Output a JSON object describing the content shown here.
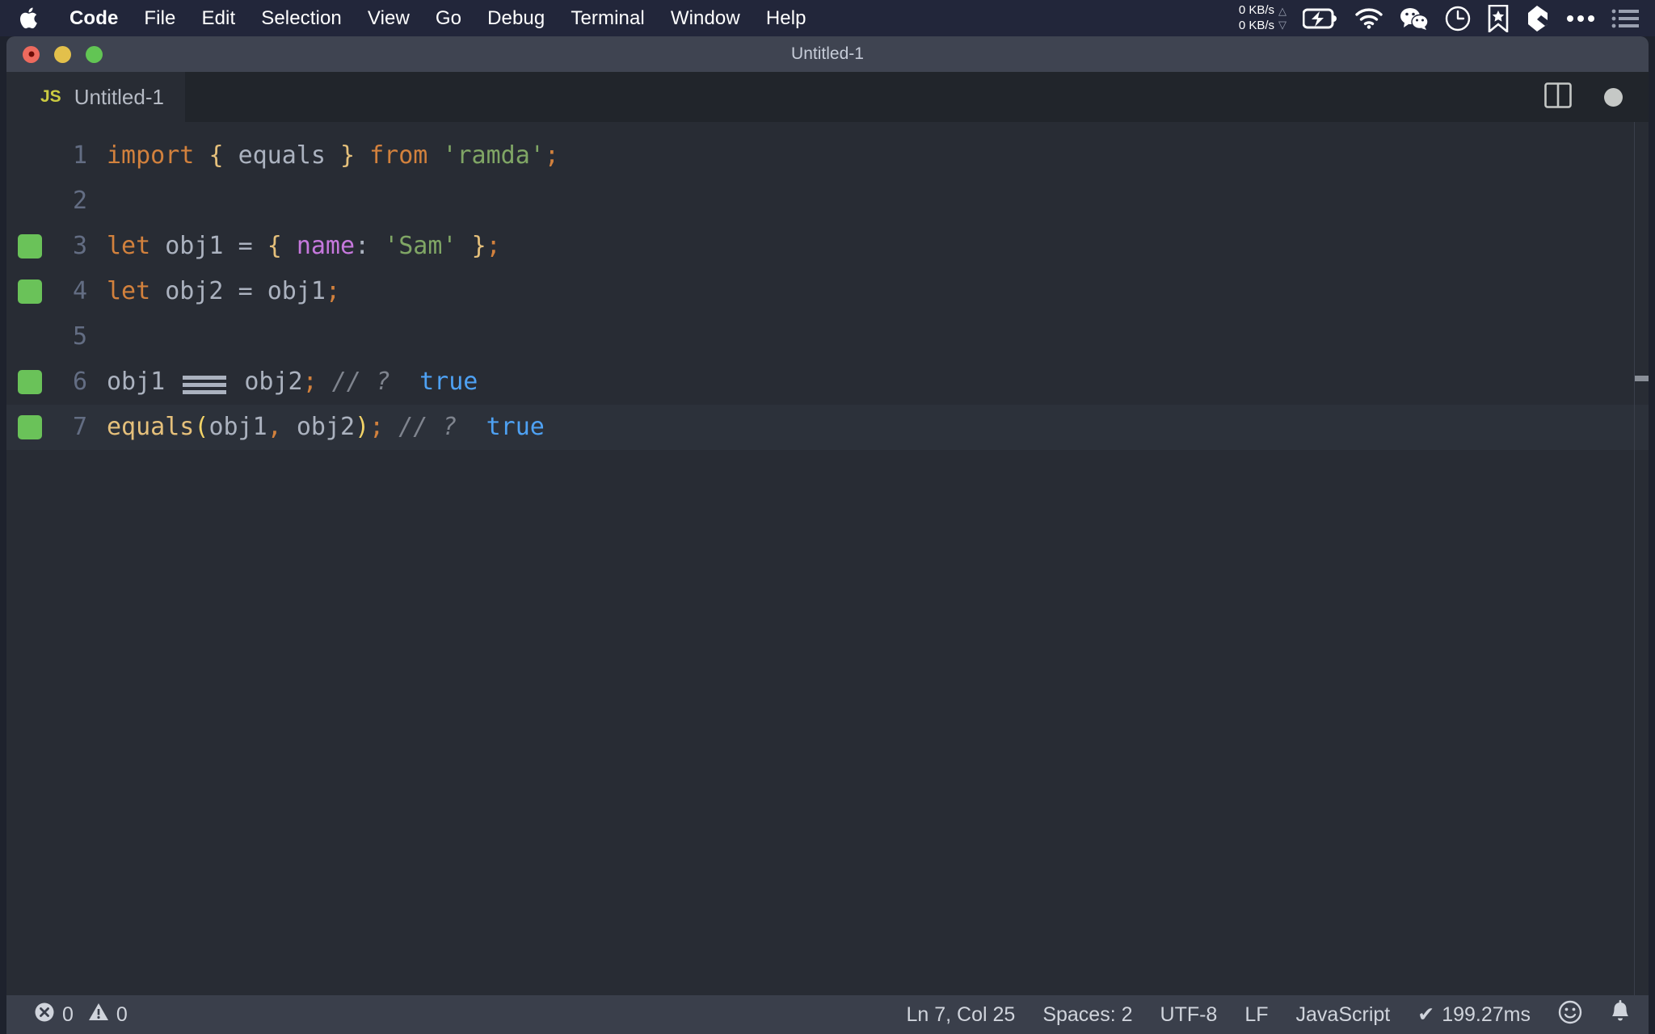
{
  "menubar": {
    "apple_icon": "apple-logo-icon",
    "items": [
      {
        "label": "Code",
        "bold": true
      },
      {
        "label": "File",
        "bold": false
      },
      {
        "label": "Edit",
        "bold": false
      },
      {
        "label": "Selection",
        "bold": false
      },
      {
        "label": "View",
        "bold": false
      },
      {
        "label": "Go",
        "bold": false
      },
      {
        "label": "Debug",
        "bold": false
      },
      {
        "label": "Terminal",
        "bold": false
      },
      {
        "label": "Window",
        "bold": false
      },
      {
        "label": "Help",
        "bold": false
      }
    ],
    "tray": {
      "net_up": "0 KB/s",
      "net_down": "0 KB/s",
      "arrow_up": "△",
      "arrow_down": "▽",
      "icons": [
        "battery-charging-icon",
        "wifi-icon",
        "wechat-icon",
        "clock-icon",
        "bookmark-star-icon",
        "eraser-icon",
        "ellipsis-icon",
        "list-menu-icon"
      ]
    }
  },
  "window": {
    "title": "Untitled-1",
    "traffic_lights": [
      "close-button",
      "minimize-button",
      "maximize-button"
    ]
  },
  "tab": {
    "file_icon_label": "JS",
    "label": "Untitled-1",
    "actions": [
      "split-editor-icon",
      "unsaved-indicator"
    ]
  },
  "editor": {
    "lines": [
      {
        "number": "1",
        "marker": false,
        "current": false,
        "tokens": [
          {
            "text": "import",
            "cls": "t-keyword"
          },
          {
            "text": " ",
            "cls": "t-punct"
          },
          {
            "text": "{",
            "cls": "t-brace"
          },
          {
            "text": " ",
            "cls": "t-punct"
          },
          {
            "text": "equals",
            "cls": "t-ident"
          },
          {
            "text": " ",
            "cls": "t-punct"
          },
          {
            "text": "}",
            "cls": "t-brace"
          },
          {
            "text": " ",
            "cls": "t-punct"
          },
          {
            "text": "from",
            "cls": "t-keyword"
          },
          {
            "text": " ",
            "cls": "t-punct"
          },
          {
            "text": "'ramda'",
            "cls": "t-string"
          },
          {
            "text": ";",
            "cls": "t-semi"
          }
        ]
      },
      {
        "number": "2",
        "marker": false,
        "current": false,
        "tokens": []
      },
      {
        "number": "3",
        "marker": true,
        "current": false,
        "tokens": [
          {
            "text": "let",
            "cls": "t-keyword"
          },
          {
            "text": " ",
            "cls": "t-punct"
          },
          {
            "text": "obj1",
            "cls": "t-ident"
          },
          {
            "text": " ",
            "cls": "t-punct"
          },
          {
            "text": "=",
            "cls": "t-op"
          },
          {
            "text": " ",
            "cls": "t-punct"
          },
          {
            "text": "{",
            "cls": "t-brace"
          },
          {
            "text": " ",
            "cls": "t-punct"
          },
          {
            "text": "name",
            "cls": "t-prop"
          },
          {
            "text": ":",
            "cls": "t-punct"
          },
          {
            "text": " ",
            "cls": "t-punct"
          },
          {
            "text": "'Sam'",
            "cls": "t-string"
          },
          {
            "text": " ",
            "cls": "t-punct"
          },
          {
            "text": "}",
            "cls": "t-brace"
          },
          {
            "text": ";",
            "cls": "t-semi"
          }
        ]
      },
      {
        "number": "4",
        "marker": true,
        "current": false,
        "tokens": [
          {
            "text": "let",
            "cls": "t-keyword"
          },
          {
            "text": " ",
            "cls": "t-punct"
          },
          {
            "text": "obj2",
            "cls": "t-ident"
          },
          {
            "text": " ",
            "cls": "t-punct"
          },
          {
            "text": "=",
            "cls": "t-op"
          },
          {
            "text": " ",
            "cls": "t-punct"
          },
          {
            "text": "obj1",
            "cls": "t-ident"
          },
          {
            "text": ";",
            "cls": "t-semi"
          }
        ]
      },
      {
        "number": "5",
        "marker": false,
        "current": false,
        "tokens": []
      },
      {
        "number": "6",
        "marker": true,
        "current": false,
        "tokens": [
          {
            "text": "obj1",
            "cls": "t-ident"
          },
          {
            "text": " ",
            "cls": "t-punct"
          },
          {
            "text": "===",
            "cls": "t-op",
            "ligature": true
          },
          {
            "text": " ",
            "cls": "t-punct"
          },
          {
            "text": "obj2",
            "cls": "t-ident"
          },
          {
            "text": ";",
            "cls": "t-semi"
          },
          {
            "text": " ",
            "cls": "t-punct"
          },
          {
            "text": "// ?",
            "cls": "t-comment"
          },
          {
            "text": "  ",
            "cls": "t-punct"
          },
          {
            "text": "true",
            "cls": "t-value"
          }
        ]
      },
      {
        "number": "7",
        "marker": true,
        "current": true,
        "tokens": [
          {
            "text": "equals",
            "cls": "t-fn"
          },
          {
            "text": "(",
            "cls": "t-paren"
          },
          {
            "text": "obj1",
            "cls": "t-ident"
          },
          {
            "text": ",",
            "cls": "t-semi"
          },
          {
            "text": " ",
            "cls": "t-punct"
          },
          {
            "text": "obj2",
            "cls": "t-ident"
          },
          {
            "text": ")",
            "cls": "t-paren"
          },
          {
            "text": ";",
            "cls": "t-semi"
          },
          {
            "text": " ",
            "cls": "t-punct"
          },
          {
            "text": "// ?",
            "cls": "t-comment"
          },
          {
            "text": "  ",
            "cls": "t-punct"
          },
          {
            "text": "true",
            "cls": "t-value"
          }
        ]
      }
    ]
  },
  "statusbar": {
    "errors_count": "0",
    "warnings_count": "0",
    "cursor_position": "Ln 7, Col 25",
    "indentation": "Spaces: 2",
    "encoding": "UTF-8",
    "eol": "LF",
    "language": "JavaScript",
    "run_check": "✔",
    "run_time": "199.27ms",
    "feedback_icon": "smiley-icon",
    "notifications_icon": "bell-icon"
  },
  "colors": {
    "menubar_bg": "#22263a",
    "titlebar_bg": "#3f4451",
    "tabrow_bg": "#21252b",
    "editor_bg": "#282c34",
    "statusbar_bg": "#3a3f4b",
    "coverage_marker": "#6ac259",
    "js_icon": "#cbcb41",
    "keyword": "#d2813d",
    "string": "#80a665",
    "property": "#c678dd",
    "brace": "#e5c07b",
    "value": "#4ea1f3",
    "comment": "#7f848e"
  }
}
